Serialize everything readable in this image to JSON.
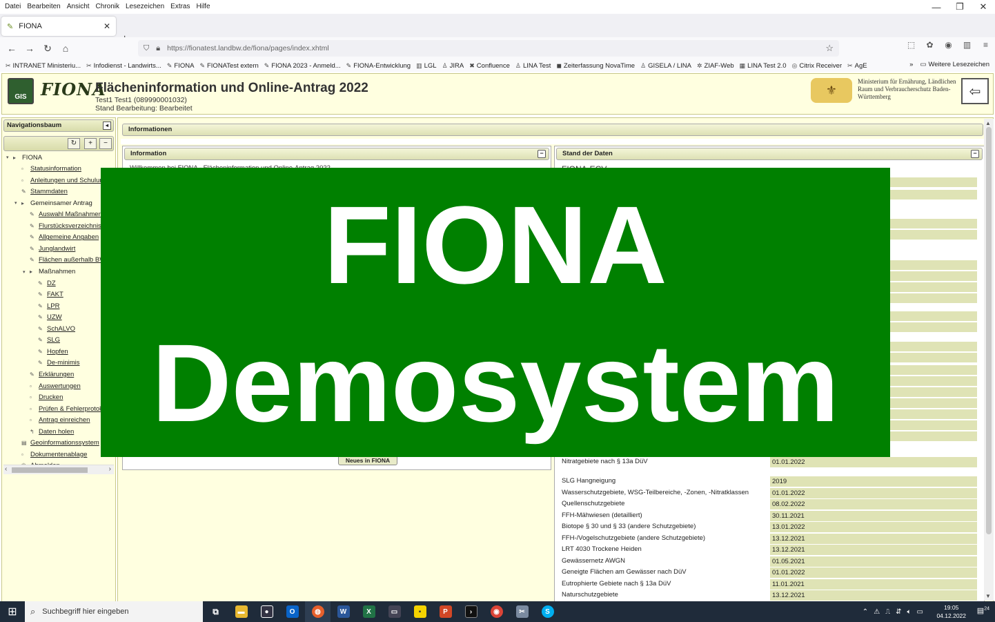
{
  "menubar": {
    "items": [
      "Datei",
      "Bearbeiten",
      "Ansicht",
      "Chronik",
      "Lesezeichen",
      "Extras",
      "Hilfe"
    ],
    "minimize_icon": "—",
    "restore_icon": "❐",
    "close_icon": "✕"
  },
  "tab": {
    "title": "FIONA",
    "close": "✕",
    "new": "+"
  },
  "navbar": {
    "url": "https://fionatest.landbw.de/fiona/pages/index.xhtml",
    "back": "←",
    "forward": "→",
    "reload": "↻",
    "home": "⌂",
    "star": "☆"
  },
  "bookmarks": {
    "items": [
      {
        "label": "INTRANET Ministeriu...",
        "icon": "✂"
      },
      {
        "label": "Infodienst - Landwirts...",
        "icon": "✂"
      },
      {
        "label": "FIONA",
        "icon": "✎"
      },
      {
        "label": "FIONATest extern",
        "icon": "✎"
      },
      {
        "label": "FIONA 2023 - Anmeld...",
        "icon": "✎"
      },
      {
        "label": "FIONA-Entwicklung",
        "icon": "✎"
      },
      {
        "label": "LGL",
        "icon": "▥"
      },
      {
        "label": "JIRA",
        "icon": "♙"
      },
      {
        "label": "Confluence",
        "icon": "✖"
      },
      {
        "label": "LINA Test",
        "icon": "♙"
      },
      {
        "label": "Zeiterfassung NovaTime",
        "icon": "◼"
      },
      {
        "label": "GISELA / LINA",
        "icon": "♙"
      },
      {
        "label": "ZIAF-Web",
        "icon": "✲"
      },
      {
        "label": "LINA Test 2.0",
        "icon": "▦"
      },
      {
        "label": "Citrix Receiver",
        "icon": "◎"
      },
      {
        "label": "AgE",
        "icon": "✂"
      }
    ],
    "more": "»",
    "other": "Weitere Lesezeichen"
  },
  "header": {
    "gis_logo": "GIS",
    "logo": "FIONA",
    "title": "Flächeninformation und Online-Antrag 2022",
    "user": "Test1 Test1 (089990001032)",
    "status": "Stand Bearbeitung: Bearbeitet",
    "ministry": "Ministerium für Ernährung, Ländlichen Raum und Verbraucherschutz Baden-Württemberg"
  },
  "nav": {
    "title": "Navigationsbaum",
    "tree": [
      {
        "label": "FIONA",
        "level": 0,
        "folder": true,
        "icon": "▸"
      },
      {
        "label": "Statusinformation",
        "level": 1,
        "icon": "▫"
      },
      {
        "label": "Anleitungen und Schulungen",
        "level": 1,
        "icon": "▫"
      },
      {
        "label": "Stammdaten",
        "level": 1,
        "icon": "✎"
      },
      {
        "label": "Gemeinsamer Antrag",
        "level": 1,
        "folder": true,
        "icon": "▸"
      },
      {
        "label": "Auswahl Maßnahmen",
        "level": 2,
        "icon": "✎"
      },
      {
        "label": "Flurstücksverzeichnis",
        "level": 2,
        "icon": "✎"
      },
      {
        "label": "Allgemeine Angaben",
        "level": 2,
        "icon": "✎"
      },
      {
        "label": "Junglandwirt",
        "level": 2,
        "icon": "✎"
      },
      {
        "label": "Flächen außerhalb BW",
        "level": 2,
        "icon": "✎"
      },
      {
        "label": "Maßnahmen",
        "level": 2,
        "folder": true,
        "icon": "▸"
      },
      {
        "label": "DZ",
        "level": 3,
        "icon": "✎"
      },
      {
        "label": "FAKT",
        "level": 3,
        "icon": "✎"
      },
      {
        "label": "LPR",
        "level": 3,
        "icon": "✎"
      },
      {
        "label": "UZW",
        "level": 3,
        "icon": "✎"
      },
      {
        "label": "SchALVO",
        "level": 3,
        "icon": "✎"
      },
      {
        "label": "SLG",
        "level": 3,
        "icon": "✎"
      },
      {
        "label": "Hopfen",
        "level": 3,
        "icon": "✎"
      },
      {
        "label": "De-minimis",
        "level": 3,
        "icon": "✎"
      },
      {
        "label": "Erklärungen",
        "level": 2,
        "icon": "✎"
      },
      {
        "label": "Auswertungen",
        "level": 2,
        "icon": "▫"
      },
      {
        "label": "Drucken",
        "level": 2,
        "icon": "▫"
      },
      {
        "label": "Prüfen & Fehlerprotokoll",
        "level": 2,
        "icon": "▫"
      },
      {
        "label": "Antrag einreichen",
        "level": 2,
        "icon": "▫"
      },
      {
        "label": "Daten holen",
        "level": 2,
        "icon": "↰"
      },
      {
        "label": "Geoinformationssystem",
        "level": 1,
        "icon": "▤"
      },
      {
        "label": "Dokumentenablage",
        "level": 1,
        "icon": "▫"
      },
      {
        "label": "Abmelden",
        "level": 1,
        "icon": "⏻"
      }
    ]
  },
  "main": {
    "info_title": "Informationen",
    "info_panel_title": "Information",
    "welcome": "Willkommen bei FIONA - Flächeninformation und Online-Antrag 2022",
    "neues_button": "Neues in FIONA",
    "stand_title": "Stand der Daten",
    "stand_heading": "FIONA-ECV",
    "rows_top": [
      {
        "label": "Nitratgebiete nach § 13a DüV",
        "value": "01.01.2022"
      }
    ],
    "rows": [
      {
        "label": "SLG Hangneigung",
        "value": "2019"
      },
      {
        "label": "Wasserschutzgebiete, WSG-Teilbereiche, -Zonen, -Nitratklassen",
        "value": "01.01.2022"
      },
      {
        "label": "Quellenschutzgebiete",
        "value": "08.02.2022"
      },
      {
        "label": "FFH-Mähwiesen (detailliert)",
        "value": "30.11.2021"
      },
      {
        "label": "Biotope § 30 und § 33 (andere Schutzgebiete)",
        "value": "13.01.2022"
      },
      {
        "label": "FFH-/Vogelschutzgebiete (andere Schutzgebiete)",
        "value": "13.12.2021"
      },
      {
        "label": "LRT 4030 Trockene Heiden",
        "value": "13.12.2021"
      },
      {
        "label": "Gewässernetz AWGN",
        "value": "01.05.2021"
      },
      {
        "label": "Geneigte Flächen am Gewässer nach DüV",
        "value": "01.01.2022"
      },
      {
        "label": "Eutrophierte Gebiete nach § 13a DüV",
        "value": "11.01.2021"
      },
      {
        "label": "Naturschutzgebiete",
        "value": "13.12.2021"
      }
    ]
  },
  "overlay": {
    "line1": "FIONA",
    "line2": "Demosystem",
    "color": "#008000"
  },
  "taskbar": {
    "search_placeholder": "Suchbegriff hier eingeben",
    "time": "19:05",
    "date": "04.12.2022",
    "notifications": "24"
  }
}
